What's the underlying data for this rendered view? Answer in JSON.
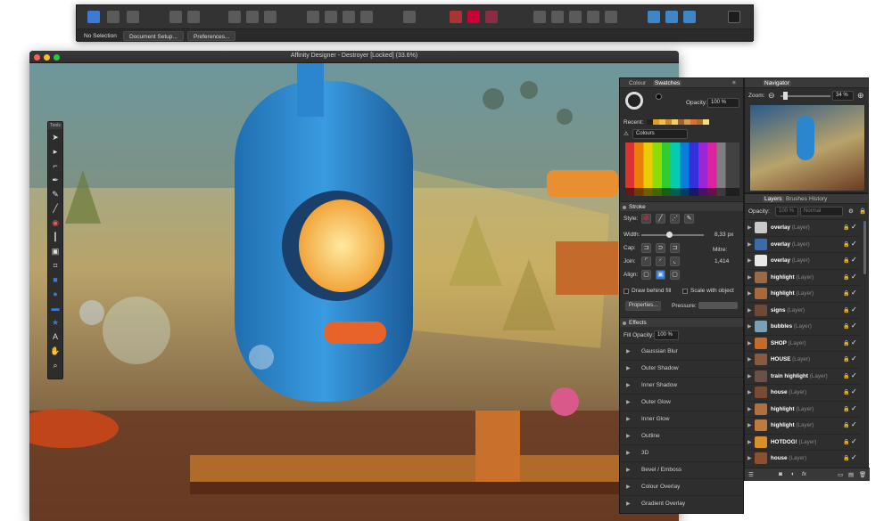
{
  "toolbar": {
    "context_items": [
      {
        "label": "No Selection"
      },
      {
        "label": "Document Setup..."
      },
      {
        "label": "Preferences..."
      }
    ],
    "icons": [
      "designer-persona-icon",
      "pixel-persona-icon",
      "export-persona-icon",
      "view-mode-icon",
      "snapping-icon",
      "align-icon",
      "distribute-icon",
      "transform-icon",
      "grid-icon",
      "arrange-icon",
      "boolean-icon",
      "colour-icon",
      "insert-icon",
      "assistant-icon",
      "geometry-icon",
      "info-icon"
    ]
  },
  "window": {
    "title": "Affinity Designer - Destroyer [Locked] (33.6%)"
  },
  "tools": {
    "label": "Tools",
    "items": [
      "move-tool-icon",
      "node-tool-icon",
      "corner-tool-icon",
      "pen-tool-icon",
      "pencil-tool-icon",
      "brush-tool-icon",
      "fill-tool-icon",
      "transparency-tool-icon",
      "place-image-icon",
      "crop-tool-icon",
      "rectangle-tool-icon",
      "ellipse-tool-icon",
      "rounded-rect-tool-icon",
      "star-tool-icon",
      "text-tool-icon",
      "hand-tool-icon",
      "zoom-tool-icon"
    ]
  },
  "colour_panel": {
    "tabs": [
      "Colour",
      "Swatches"
    ],
    "opacity_label": "Opacity:",
    "opacity_value": "100 %",
    "recent_label": "Recent:",
    "palette_name": "Colours"
  },
  "stroke_panel": {
    "title": "Stroke",
    "style_label": "Style:",
    "width_label": "Width:",
    "width_value": "8,33 px",
    "cap_label": "Cap:",
    "join_label": "Join:",
    "mitre_label": "Mitre:",
    "mitre_value": "1,414",
    "align_label": "Align:",
    "draw_behind_fill": "Draw behind fill",
    "scale_with_object": "Scale with object",
    "properties_button": "Properties...",
    "pressure_label": "Pressure:"
  },
  "effects_panel": {
    "title": "Effects",
    "fill_opacity_label": "Fill Opacity:",
    "fill_opacity_value": "100 %",
    "items": [
      "Gaussian Blur",
      "Outer Shadow",
      "Inner Shadow",
      "Outer Glow",
      "Inner Glow",
      "Outline",
      "3D",
      "Bevel / Emboss",
      "Colour Overlay",
      "Gradient Overlay"
    ]
  },
  "navigator_panel": {
    "tab": "Navigator",
    "zoom_label": "Zoom:",
    "zoom_value": "34 %"
  },
  "layers_panel": {
    "tabs": [
      "Layers",
      "Brushes",
      "History"
    ],
    "opacity_label": "Opacity:",
    "opacity_value": "100 %",
    "blend_mode": "Normal",
    "layer_type": "(Layer)",
    "layers": [
      {
        "name": "overlay",
        "thumb": "#c9c9c9"
      },
      {
        "name": "overlay",
        "thumb": "#3f6aa8"
      },
      {
        "name": "overlay",
        "thumb": "#e8e8e8"
      },
      {
        "name": "highlight",
        "thumb": "#9a6a44"
      },
      {
        "name": "highlight",
        "thumb": "#a8683a"
      },
      {
        "name": "signs",
        "thumb": "#6d4a34"
      },
      {
        "name": "bubbles",
        "thumb": "#7aa0b8"
      },
      {
        "name": "SHOP",
        "thumb": "#c46a2a"
      },
      {
        "name": "HOUSE",
        "thumb": "#8a5a40"
      },
      {
        "name": "train highlight",
        "thumb": "#6b5048"
      },
      {
        "name": "house",
        "thumb": "#7b4a35"
      },
      {
        "name": "highlight",
        "thumb": "#b07040"
      },
      {
        "name": "highlight",
        "thumb": "#c07a3a"
      },
      {
        "name": "HOTDOG!",
        "thumb": "#d8902a"
      },
      {
        "name": "house",
        "thumb": "#8a5030"
      }
    ]
  },
  "colors": {
    "panel_bg": "#2e2e2e",
    "accent_blue": "#3b7bd6"
  }
}
